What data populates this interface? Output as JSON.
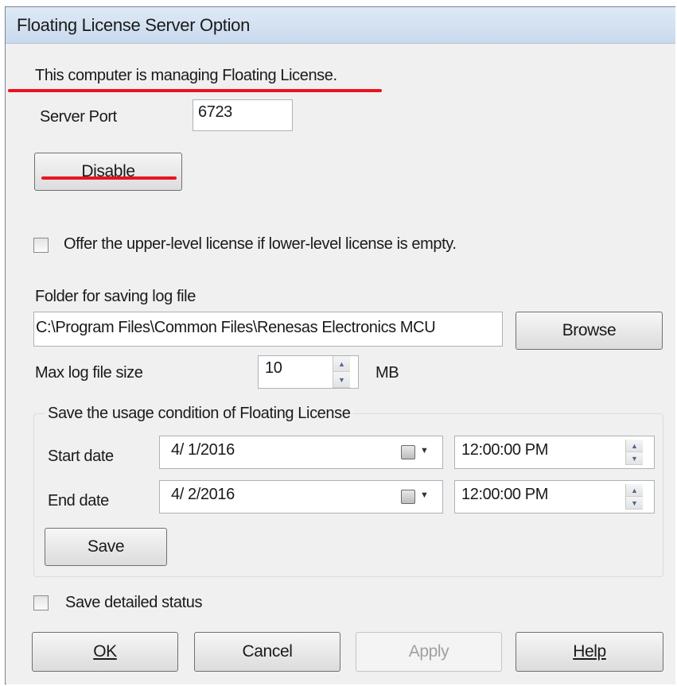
{
  "dialog": {
    "title": "Floating License Server Option"
  },
  "status": {
    "message": "This computer is managing Floating License."
  },
  "server_port": {
    "label": "Server Port",
    "value": "6723"
  },
  "disable_button": {
    "label": "Disable"
  },
  "offer_upper_level": {
    "label": "Offer the upper-level license if lower-level license is empty.",
    "checked": false
  },
  "log_folder": {
    "label": "Folder for saving log file",
    "value": "C:\\Program Files\\Common Files\\Renesas Electronics MCU",
    "browse_label": "Browse"
  },
  "max_log_size": {
    "label": "Max log file size",
    "value": "10",
    "unit": "MB"
  },
  "usage_group": {
    "title": "Save the usage condition of Floating License",
    "start_label": "Start date",
    "start_date": "4/ 1/2016",
    "start_time": "12:00:00 PM",
    "end_label": "End date",
    "end_date": "4/ 2/2016",
    "end_time": "12:00:00 PM",
    "save_label": "Save"
  },
  "detailed_status": {
    "label": "Save detailed status",
    "checked": false
  },
  "footer": {
    "ok_label": "OK",
    "cancel_label": "Cancel",
    "apply_label": "Apply",
    "help_label": "Help"
  },
  "colors": {
    "annotation_red": "#e8141f",
    "titlebar": "#c9daee",
    "dialog_bg": "#f0f0f0"
  }
}
